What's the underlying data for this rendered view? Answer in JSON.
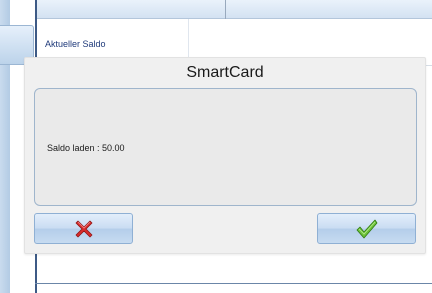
{
  "background": {
    "saldo_label": "Aktueller Saldo"
  },
  "dialog": {
    "title": "SmartCard",
    "message": "Saldo laden : 50.00",
    "cancel_icon": "red-x-icon",
    "confirm_icon": "green-check-icon"
  },
  "colors": {
    "accent_blue": "#3d5a86",
    "cancel_red": "#d92b2b",
    "confirm_green": "#5aab2a"
  }
}
